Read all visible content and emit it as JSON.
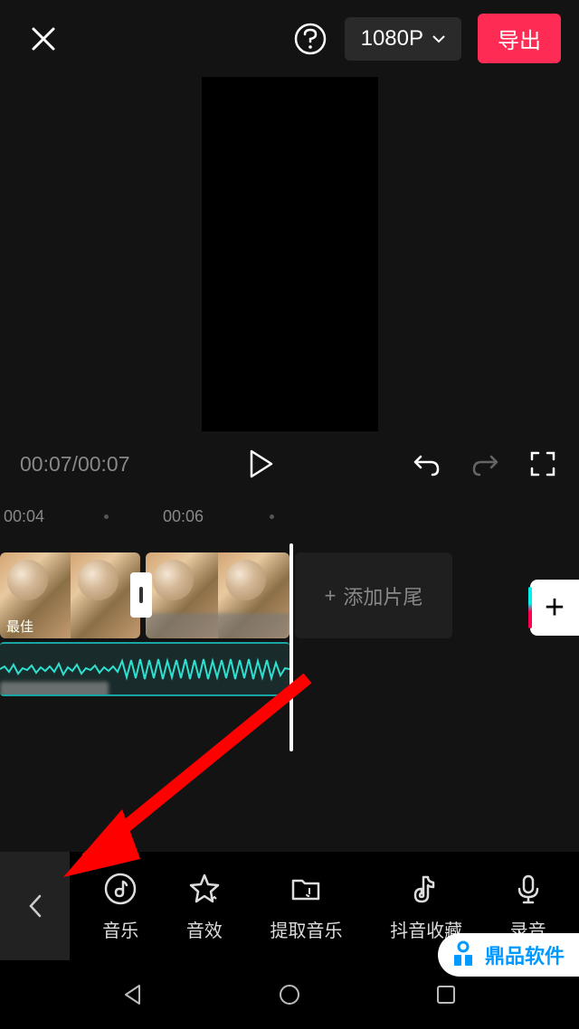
{
  "header": {
    "resolution_label": "1080P",
    "export_label": "导出"
  },
  "transport": {
    "current_time": "00:07",
    "total_time": "00:07"
  },
  "ruler": {
    "mark1": "00:04",
    "mark2": "00:06"
  },
  "timeline": {
    "add_tail_label": "添加片尾",
    "clip_caption": "最佳"
  },
  "toolbar": {
    "items": [
      {
        "icon": "music",
        "label": "音乐"
      },
      {
        "icon": "star",
        "label": "音效"
      },
      {
        "icon": "folder",
        "label": "提取音乐"
      },
      {
        "icon": "douyin",
        "label": "抖音收藏"
      },
      {
        "icon": "mic",
        "label": "录音"
      }
    ]
  },
  "watermark": {
    "text": "鼎品软件"
  }
}
